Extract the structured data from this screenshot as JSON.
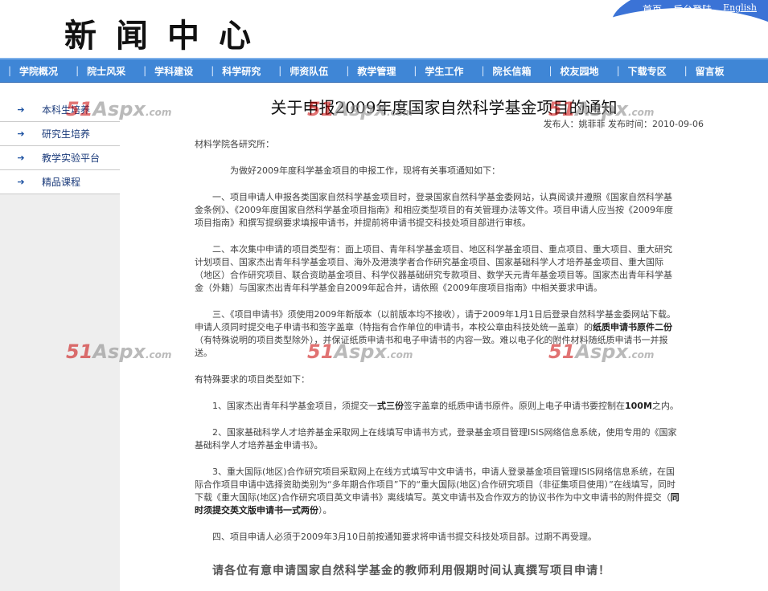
{
  "header": {
    "site_title": "新闻中心",
    "links": {
      "home": "首页",
      "admin": "后台登陆",
      "english": "English"
    }
  },
  "nav": {
    "items": [
      "学院概况",
      "院士风采",
      "学科建设",
      "科学研究",
      "师资队伍",
      "教学管理",
      "学生工作",
      "院长信箱",
      "校友园地",
      "下载专区",
      "留言板"
    ]
  },
  "sidebar": {
    "items": [
      "本科生培养",
      "研究生培养",
      "教学实验平台",
      "精品课程"
    ]
  },
  "article": {
    "title": "关于申报2009年度国家自然科学基金项目的通知",
    "meta": "发布人：姚菲菲  发布时间：2010-09-06",
    "salutation": "材料学院各研究所：",
    "intro": "为做好2009年度科学基金项目的申报工作，现将有关事项通知如下：",
    "p1": "一、项目申请人申报各类国家自然科学基金项目时，登录国家自然科学基金委网站，认真阅读并遵照《国家自然科学基金条例》、《2009年度国家自然科学基金项目指南》和相应类型项目的有关管理办法等文件。项目申请人应当按《2009年度项目指南》和撰写提纲要求填报申请书，并提前将申请书提交科技处项目部进行审核。",
    "p2": "二、本次集中申请的项目类型有：面上项目、青年科学基金项目、地区科学基金项目、重点项目、重大项目、重大研究计划项目、国家杰出青年科学基金项目、海外及港澳学者合作研究基金项目、国家基础科学人才培养基金项目、重大国际（地区）合作研究项目、联合资助基金项目、科学仪器基础研究专款项目、数学天元青年基金项目等。国家杰出青年科学基金（外籍）与国家杰出青年科学基金自2009年起合并，请依照《2009年度项目指南》中相关要求申请。",
    "p3_a": "三、《项目申请书》须使用2009年新版本（以前版本均不接收），请于2009年1月1日后登录自然科学基金委网站下载。申请人须同时提交电子申请书和签字盖章（特指有合作单位的申请书，本校公章由科技处统一盖章）的",
    "p3_b": "纸质申请书原件二份",
    "p3_c": "（有特殊说明的项目类型除外），并保证纸质申请书和电子申请书的内容一致。难以电子化的附件材料随纸质申请书一并报送。",
    "special_heading": "有特殊要求的项目类型如下：",
    "s1_a": "1、国家杰出青年科学基金项目，须提交一",
    "s1_b": "式三份",
    "s1_c": "签字盖章的纸质申请书原件。原则上电子申请书要控制在",
    "s1_d": "100M",
    "s1_e": "之内。",
    "s2": "2、国家基础科学人才培养基金采取网上在线填写申请书方式，登录基金项目管理ISIS网络信息系统，使用专用的《国家基础科学人才培养基金申请书》。",
    "s3_a": "3、重大国际(地区)合作研究项目采取网上在线方式填写中文申请书，申请人登录基金项目管理ISIS网络信息系统，在国际合作项目申请中选择资助类别为“多年期合作项目”下的“重大国际(地区)合作研究项目（非征集项目使用）”在线填写，同时下载《重大国际(地区)合作研究项目英文申请书》离线填写。英文申请书及合作双方的协议书作为中文申请书的附件提交（",
    "s3_b": "同时须提交英文版申请书一式两份",
    "s3_c": "）。",
    "p4": "四、项目申请人必须于2009年3月10日前按通知要求将申请书提交科技处项目部。过期不再受理。",
    "closing": "请各位有意申请国家自然科学基金的教师利用假期时间认真撰写项目申请！"
  },
  "watermark": {
    "num": "51",
    "brand": "Aspx",
    "tld": ".com"
  }
}
